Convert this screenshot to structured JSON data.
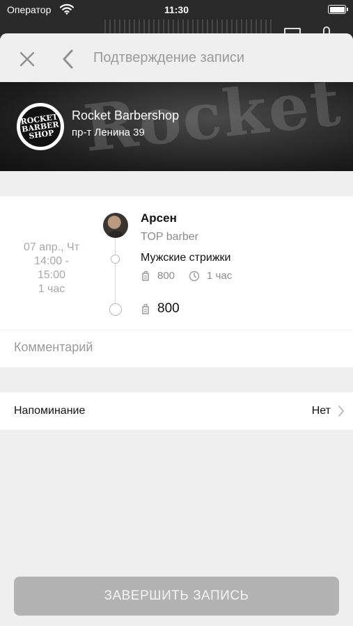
{
  "status_bar": {
    "carrier": "Оператор",
    "time": "11:30"
  },
  "header": {
    "title": "Подтверждение записи"
  },
  "shop": {
    "name": "Rocket Barbershop",
    "address": "пр-т Ленина 39",
    "logo_text": "ROCKET BARBERSHOP",
    "banner_watermark": "Rocket"
  },
  "booking": {
    "date": "07 апр., Чт",
    "time_from": "14:00 -",
    "time_to": "15:00",
    "duration": "1 час",
    "master_name": "Арсен",
    "master_role": "TOP barber",
    "service_name": "Мужские стрижки",
    "service_price": "800",
    "service_duration": "1 час",
    "total": "800"
  },
  "comment": {
    "placeholder": "Комментарий",
    "value": ""
  },
  "reminder": {
    "label": "Напоминание",
    "value": "Нет"
  },
  "actions": {
    "finish_label": "ЗАВЕРШИТЬ ЗАПИСЬ"
  },
  "colors": {
    "sheet_background": "#efefef",
    "button_disabled": "#b3b3b3",
    "muted_text": "#9a9a9a"
  },
  "icons": [
    "wifi-icon",
    "battery-icon",
    "close-icon",
    "back-chevron-icon",
    "price-tag-icon",
    "clock-icon",
    "chevron-right-icon"
  ]
}
